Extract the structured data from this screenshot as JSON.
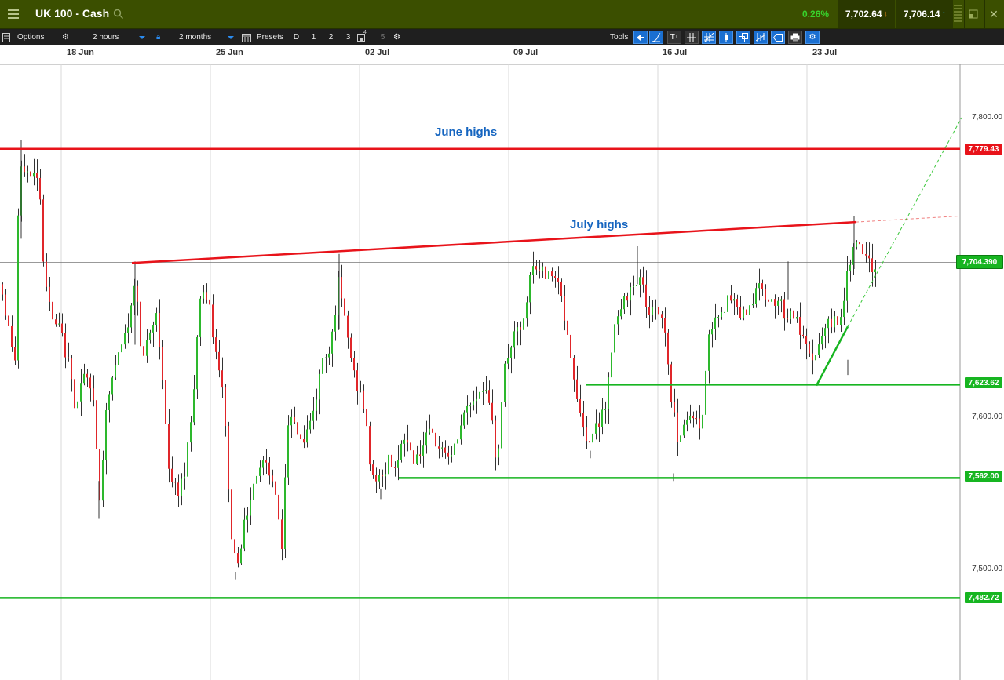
{
  "header": {
    "instrument": "UK 100 - Cash",
    "change": "0.26%",
    "sell_price": "7,702.64",
    "buy_price": "7,706.14",
    "change_color": "#38d32c"
  },
  "toolbar": {
    "options_label": "Options",
    "interval": "2 hours",
    "range": "2 months",
    "presets_label": "Presets",
    "presets": [
      "D",
      "1",
      "2",
      "3",
      "5"
    ],
    "preset_badge": "4",
    "tools_label": "Tools"
  },
  "dates": [
    "18 Jun",
    "25 Jun",
    "02 Jul",
    "09 Jul",
    "16 Jul",
    "23 Jul"
  ],
  "price_axis": [
    "7,800.00",
    "7,600.00",
    "7,500.00"
  ],
  "levels": {
    "june_high": "7,779.43",
    "current": "7,704.390",
    "support_1": "7,623.62",
    "support_2": "7,562.00",
    "support_3": "7,482.72"
  },
  "annotations": {
    "june": "June highs",
    "july": "July highs"
  },
  "colors": {
    "up": "#2db82d",
    "down": "#e0262a",
    "resistance": "#e8131a",
    "support": "#17b521",
    "annotation": "#1565c0"
  }
}
